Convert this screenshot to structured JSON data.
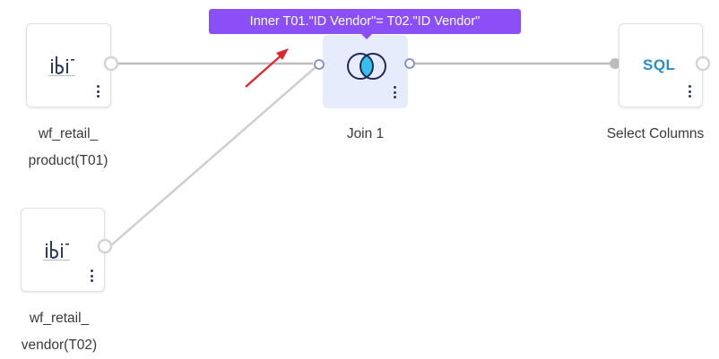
{
  "nodes": {
    "product": {
      "icon": "ibi-logo-icon",
      "label_line1": "wf_retail_",
      "label_line2": "product(T01)"
    },
    "vendor": {
      "icon": "ibi-logo-icon",
      "label_line1": "wf_retail_",
      "label_line2": "vendor(T02)"
    },
    "join": {
      "icon": "venn-join-icon",
      "label": "Join 1"
    },
    "select": {
      "icon_text": "SQL",
      "label": "Select Columns"
    }
  },
  "tooltip": {
    "text": "Inner T01.\"ID Vendor\"= T02.\"ID Vendor\""
  },
  "colors": {
    "wire": "#bdbdbd",
    "tooltip_bg": "#8a4ff7",
    "join_bg": "#e6ecfb",
    "venn_fill": "#36c0f0",
    "port": "#7f8ad4",
    "annotation_arrow": "#e0262b",
    "sql_text": "#2a8ccf"
  }
}
